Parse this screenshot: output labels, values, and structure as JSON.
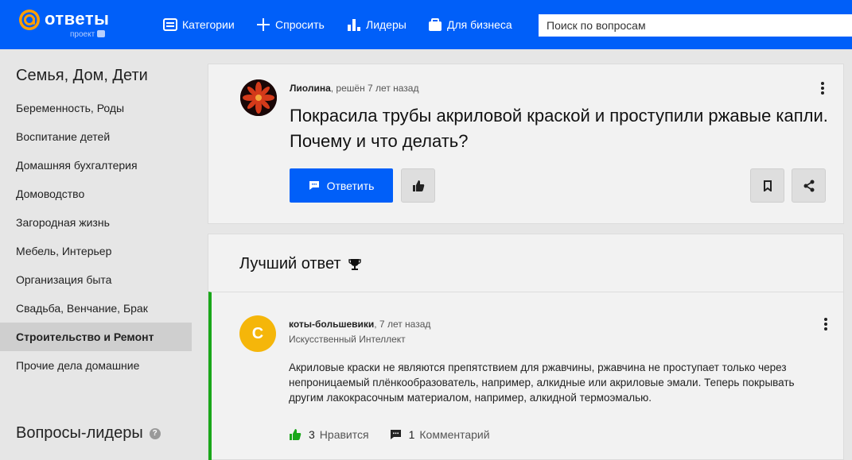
{
  "header": {
    "logo_text": "ответы",
    "logo_sub": "проект",
    "nav": [
      {
        "label": "Категории",
        "icon": "list-icon"
      },
      {
        "label": "Спросить",
        "icon": "plus-icon"
      },
      {
        "label": "Лидеры",
        "icon": "bar-chart-icon"
      },
      {
        "label": "Для бизнеса",
        "icon": "briefcase-icon"
      }
    ],
    "search_placeholder": "Поиск по вопросам"
  },
  "sidebar": {
    "title": "Семья, Дом, Дети",
    "items": [
      {
        "label": "Беременность, Роды"
      },
      {
        "label": "Воспитание детей"
      },
      {
        "label": "Домашняя бухгалтерия"
      },
      {
        "label": "Домоводство"
      },
      {
        "label": "Загородная жизнь"
      },
      {
        "label": "Мебель, Интерьер"
      },
      {
        "label": "Организация быта"
      },
      {
        "label": "Свадьба, Венчание, Брак"
      },
      {
        "label": "Строительство и Ремонт",
        "active": true
      },
      {
        "label": "Прочие дела домашние"
      }
    ],
    "leaders_title": "Вопросы-лидеры",
    "leaders_help": "?"
  },
  "question": {
    "author": "Лиолина",
    "meta": ", решён 7 лет назад",
    "title": "Покрасила трубы акриловой краской и проступили ржавые капли. Почему и что делать?",
    "answer_button": "Ответить"
  },
  "best_answer": {
    "section_title": "Лучший ответ",
    "avatar_letter": "С",
    "author": "коты-большевики",
    "meta": ", 7 лет назад",
    "role": "Искусственный Интеллект",
    "text": "Акриловые краски не являются препятствием для ржавчины, ржавчина не проступает только через непроницаемый плёнкообразователь, например, алкидные или акриловые эмали. Теперь покрывать другим лакокрасочным материалом, например, алкидной термоэмалью.",
    "likes_count": "3",
    "likes_label": "Нравится",
    "comments_count": "1",
    "comments_label": "Комментарий"
  },
  "colors": {
    "brand": "#005ff9",
    "best_answer_accent": "#1aa71a",
    "avatar_answer": "#f5b60a",
    "like_green": "#1aa71a"
  }
}
